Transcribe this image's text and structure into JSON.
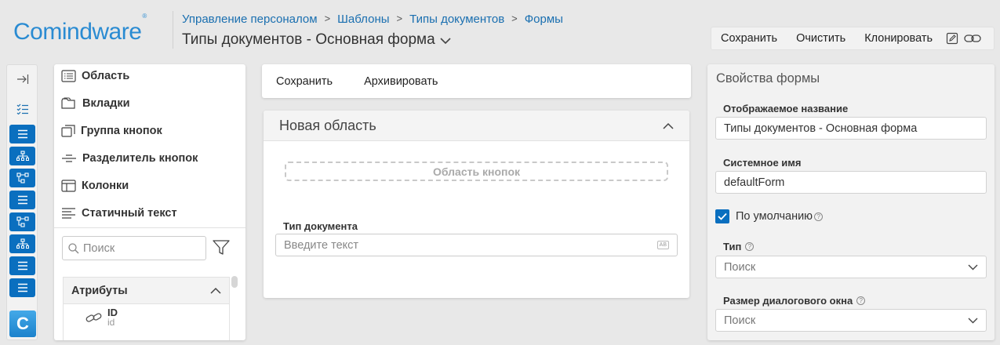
{
  "brand": {
    "logo_text": "Comindware",
    "logo_mark": "®"
  },
  "breadcrumb": [
    "Управление персоналом",
    "Шаблоны",
    "Типы документов",
    "Формы"
  ],
  "page_title": "Типы документов - Основная форма",
  "top_toolbar": {
    "save": "Сохранить",
    "clear": "Очистить",
    "clone": "Клонировать"
  },
  "rail": {
    "app_letter": "C"
  },
  "palette": {
    "items": [
      "Область",
      "Вкладки",
      "Группа кнопок",
      "Разделитель кнопок",
      "Колонки",
      "Статичный текст"
    ],
    "search_placeholder": "Поиск",
    "attributes_title": "Атрибуты",
    "attribute": {
      "name": "ID",
      "system_name": "id"
    }
  },
  "center_toolbar": {
    "save": "Сохранить",
    "archive": "Архивировать"
  },
  "area": {
    "title": "Новая область",
    "button_zone": "Область кнопок",
    "field_label": "Тип документа",
    "field_placeholder": "Введите текст",
    "field_badge": "AB"
  },
  "properties": {
    "title": "Свойства формы",
    "display_name_label": "Отображаемое название",
    "display_name_value": "Типы документов - Основная форма",
    "system_name_label": "Системное имя",
    "system_name_value": "defaultForm",
    "default_label": "По умолчанию",
    "default_checked": true,
    "type_label": "Тип",
    "type_placeholder": "Поиск",
    "dialog_size_label": "Размер диалогового окна",
    "dialog_size_placeholder": "Поиск",
    "help_glyph": "?"
  },
  "colors": {
    "accent": "#0a6fbf",
    "link": "#1a6fb0",
    "logo": "#2a8bd2"
  }
}
